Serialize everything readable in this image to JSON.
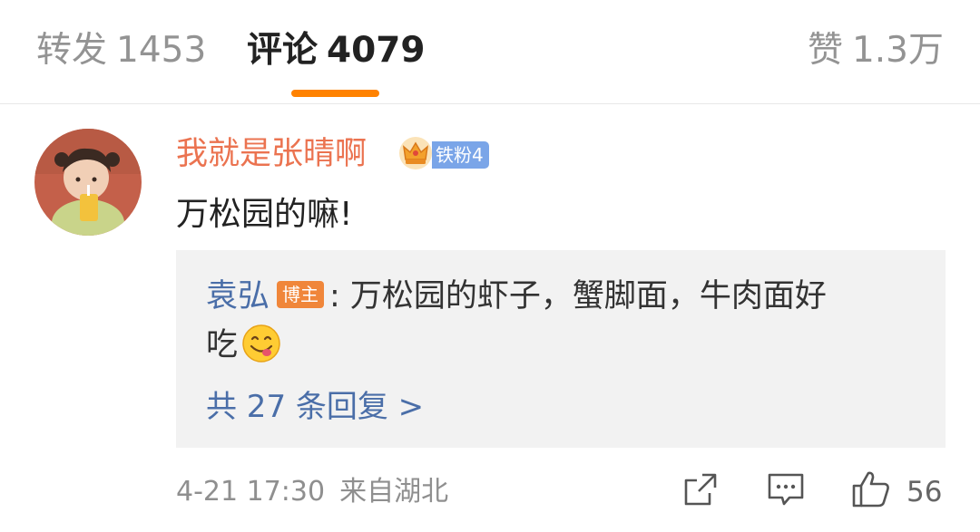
{
  "tabs": {
    "repost": {
      "label": "转发",
      "count": "1453"
    },
    "comments": {
      "label": "评论",
      "count": "4079"
    },
    "likes": {
      "label": "赞",
      "count": "1.3万"
    }
  },
  "comment": {
    "username": "我就是张晴啊",
    "fan_badge": "铁粉4",
    "text": "万松园的嘛!",
    "timestamp": "4-21 17:30",
    "source": "来自湖北",
    "like_count": "56",
    "reply": {
      "author": "袁弘",
      "author_badge": "博主",
      "text_line1": ": 万松园的虾子，蟹脚面，牛肉面好",
      "text_line2": "吃",
      "more_replies": "共 27 条回复 >"
    }
  },
  "colors": {
    "accent": "#ff8200",
    "username": "#eb7350",
    "link": "#4a6ea8",
    "reply_bg": "#f2f2f2"
  },
  "icons": [
    "crown-icon",
    "grin-emoji-icon",
    "share-icon",
    "comment-icon",
    "thumbs-up-icon"
  ]
}
